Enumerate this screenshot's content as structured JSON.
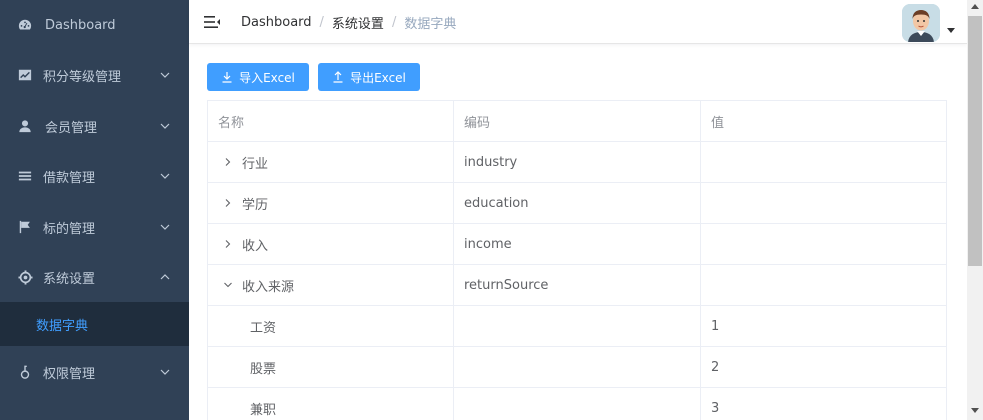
{
  "colors": {
    "sidebar_bg": "#304156",
    "sidebar_active_bg": "#1f2d3d",
    "sidebar_text": "#bfcbd9",
    "accent": "#409eff"
  },
  "sidebar": {
    "items": [
      {
        "label": "Dashboard",
        "icon": "dashboard-icon"
      },
      {
        "label": "积分等级管理",
        "icon": "chart-icon"
      },
      {
        "label": "会员管理",
        "icon": "user-icon"
      },
      {
        "label": "借款管理",
        "icon": "list-icon"
      },
      {
        "label": "标的管理",
        "icon": "flag-icon"
      },
      {
        "label": "系统设置",
        "icon": "gear-icon",
        "expanded": true
      },
      {
        "label": "权限管理",
        "icon": "lock-icon"
      }
    ],
    "submenu": {
      "label": "数据字典"
    }
  },
  "header": {
    "breadcrumb": [
      "Dashboard",
      "系统设置",
      "数据字典"
    ],
    "separator": "/"
  },
  "toolbar": {
    "import_label": "导入Excel",
    "export_label": "导出Excel"
  },
  "table": {
    "columns": [
      "名称",
      "编码",
      "值"
    ],
    "rows": [
      {
        "name": "行业",
        "code": "industry",
        "value": "",
        "expander": "collapsed"
      },
      {
        "name": "学历",
        "code": "education",
        "value": "",
        "expander": "collapsed"
      },
      {
        "name": "收入",
        "code": "income",
        "value": "",
        "expander": "collapsed"
      },
      {
        "name": "收入来源",
        "code": "returnSource",
        "value": "",
        "expander": "expanded"
      },
      {
        "name": "工资",
        "code": "",
        "value": "1",
        "child": true
      },
      {
        "name": "股票",
        "code": "",
        "value": "2",
        "child": true
      },
      {
        "name": "兼职",
        "code": "",
        "value": "3",
        "child": true
      }
    ]
  }
}
